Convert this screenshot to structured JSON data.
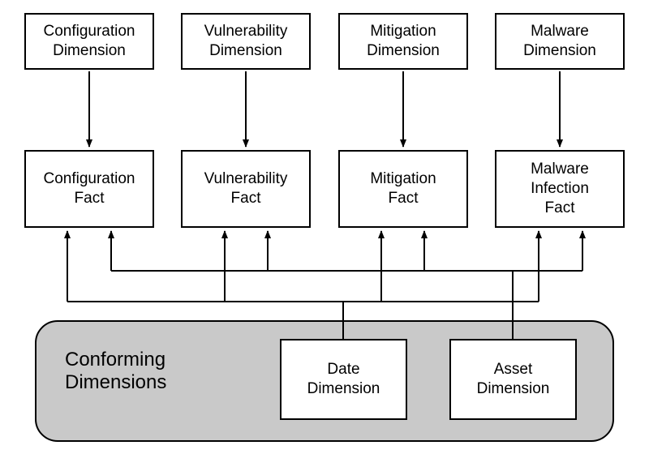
{
  "dimensions": {
    "configuration": {
      "line1": "Configuration",
      "line2": "Dimension"
    },
    "vulnerability": {
      "line1": "Vulnerability",
      "line2": "Dimension"
    },
    "mitigation": {
      "line1": "Mitigation",
      "line2": "Dimension"
    },
    "malware": {
      "line1": "Malware",
      "line2": "Dimension"
    }
  },
  "facts": {
    "configuration": {
      "line1": "Configuration",
      "line2": "Fact"
    },
    "vulnerability": {
      "line1": "Vulnerability",
      "line2": "Fact"
    },
    "mitigation": {
      "line1": "Mitigation",
      "line2": "Fact"
    },
    "malware": {
      "line1": "Malware",
      "line2": "Infection",
      "line3": "Fact"
    }
  },
  "conforming": {
    "label": "Conforming",
    "label2": "Dimensions",
    "date": {
      "line1": "Date",
      "line2": "Dimension"
    },
    "asset": {
      "line1": "Asset",
      "line2": "Dimension"
    }
  },
  "chart_data": {
    "type": "diagram",
    "nodes": [
      {
        "id": "configuration-dimension",
        "label": "Configuration Dimension",
        "group": "dimension"
      },
      {
        "id": "vulnerability-dimension",
        "label": "Vulnerability Dimension",
        "group": "dimension"
      },
      {
        "id": "mitigation-dimension",
        "label": "Mitigation Dimension",
        "group": "dimension"
      },
      {
        "id": "malware-dimension",
        "label": "Malware Dimension",
        "group": "dimension"
      },
      {
        "id": "configuration-fact",
        "label": "Configuration Fact",
        "group": "fact"
      },
      {
        "id": "vulnerability-fact",
        "label": "Vulnerability Fact",
        "group": "fact"
      },
      {
        "id": "mitigation-fact",
        "label": "Mitigation Fact",
        "group": "fact"
      },
      {
        "id": "malware-infection-fact",
        "label": "Malware Infection Fact",
        "group": "fact"
      },
      {
        "id": "date-dimension",
        "label": "Date Dimension",
        "group": "conforming"
      },
      {
        "id": "asset-dimension",
        "label": "Asset Dimension",
        "group": "conforming"
      }
    ],
    "edges": [
      {
        "from": "configuration-dimension",
        "to": "configuration-fact"
      },
      {
        "from": "vulnerability-dimension",
        "to": "vulnerability-fact"
      },
      {
        "from": "mitigation-dimension",
        "to": "mitigation-fact"
      },
      {
        "from": "malware-dimension",
        "to": "malware-infection-fact"
      },
      {
        "from": "date-dimension",
        "to": "configuration-fact"
      },
      {
        "from": "date-dimension",
        "to": "vulnerability-fact"
      },
      {
        "from": "date-dimension",
        "to": "mitigation-fact"
      },
      {
        "from": "date-dimension",
        "to": "malware-infection-fact"
      },
      {
        "from": "asset-dimension",
        "to": "configuration-fact"
      },
      {
        "from": "asset-dimension",
        "to": "vulnerability-fact"
      },
      {
        "from": "asset-dimension",
        "to": "mitigation-fact"
      },
      {
        "from": "asset-dimension",
        "to": "malware-infection-fact"
      }
    ],
    "groups": [
      {
        "id": "conforming",
        "label": "Conforming Dimensions",
        "members": [
          "date-dimension",
          "asset-dimension"
        ]
      }
    ]
  }
}
